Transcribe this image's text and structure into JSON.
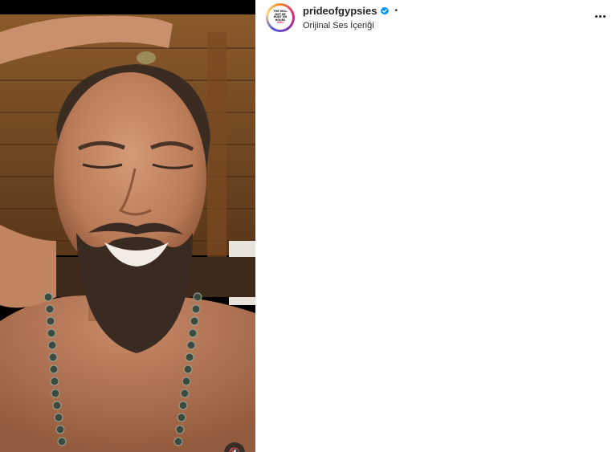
{
  "post": {
    "username": "prideofgypsies",
    "verified": true,
    "separator": "•",
    "audio": "Orijinal Ses İçeriği",
    "avatar_text": "THE WILL NOT BE BUILT ON HOURS AGO",
    "more_icon": "more-options-icon"
  },
  "media": {
    "type": "video",
    "sound_icon": "mute-icon"
  },
  "colors": {
    "verified_badge": "#0095f6",
    "text_primary": "#262626",
    "background": "#ffffff"
  }
}
